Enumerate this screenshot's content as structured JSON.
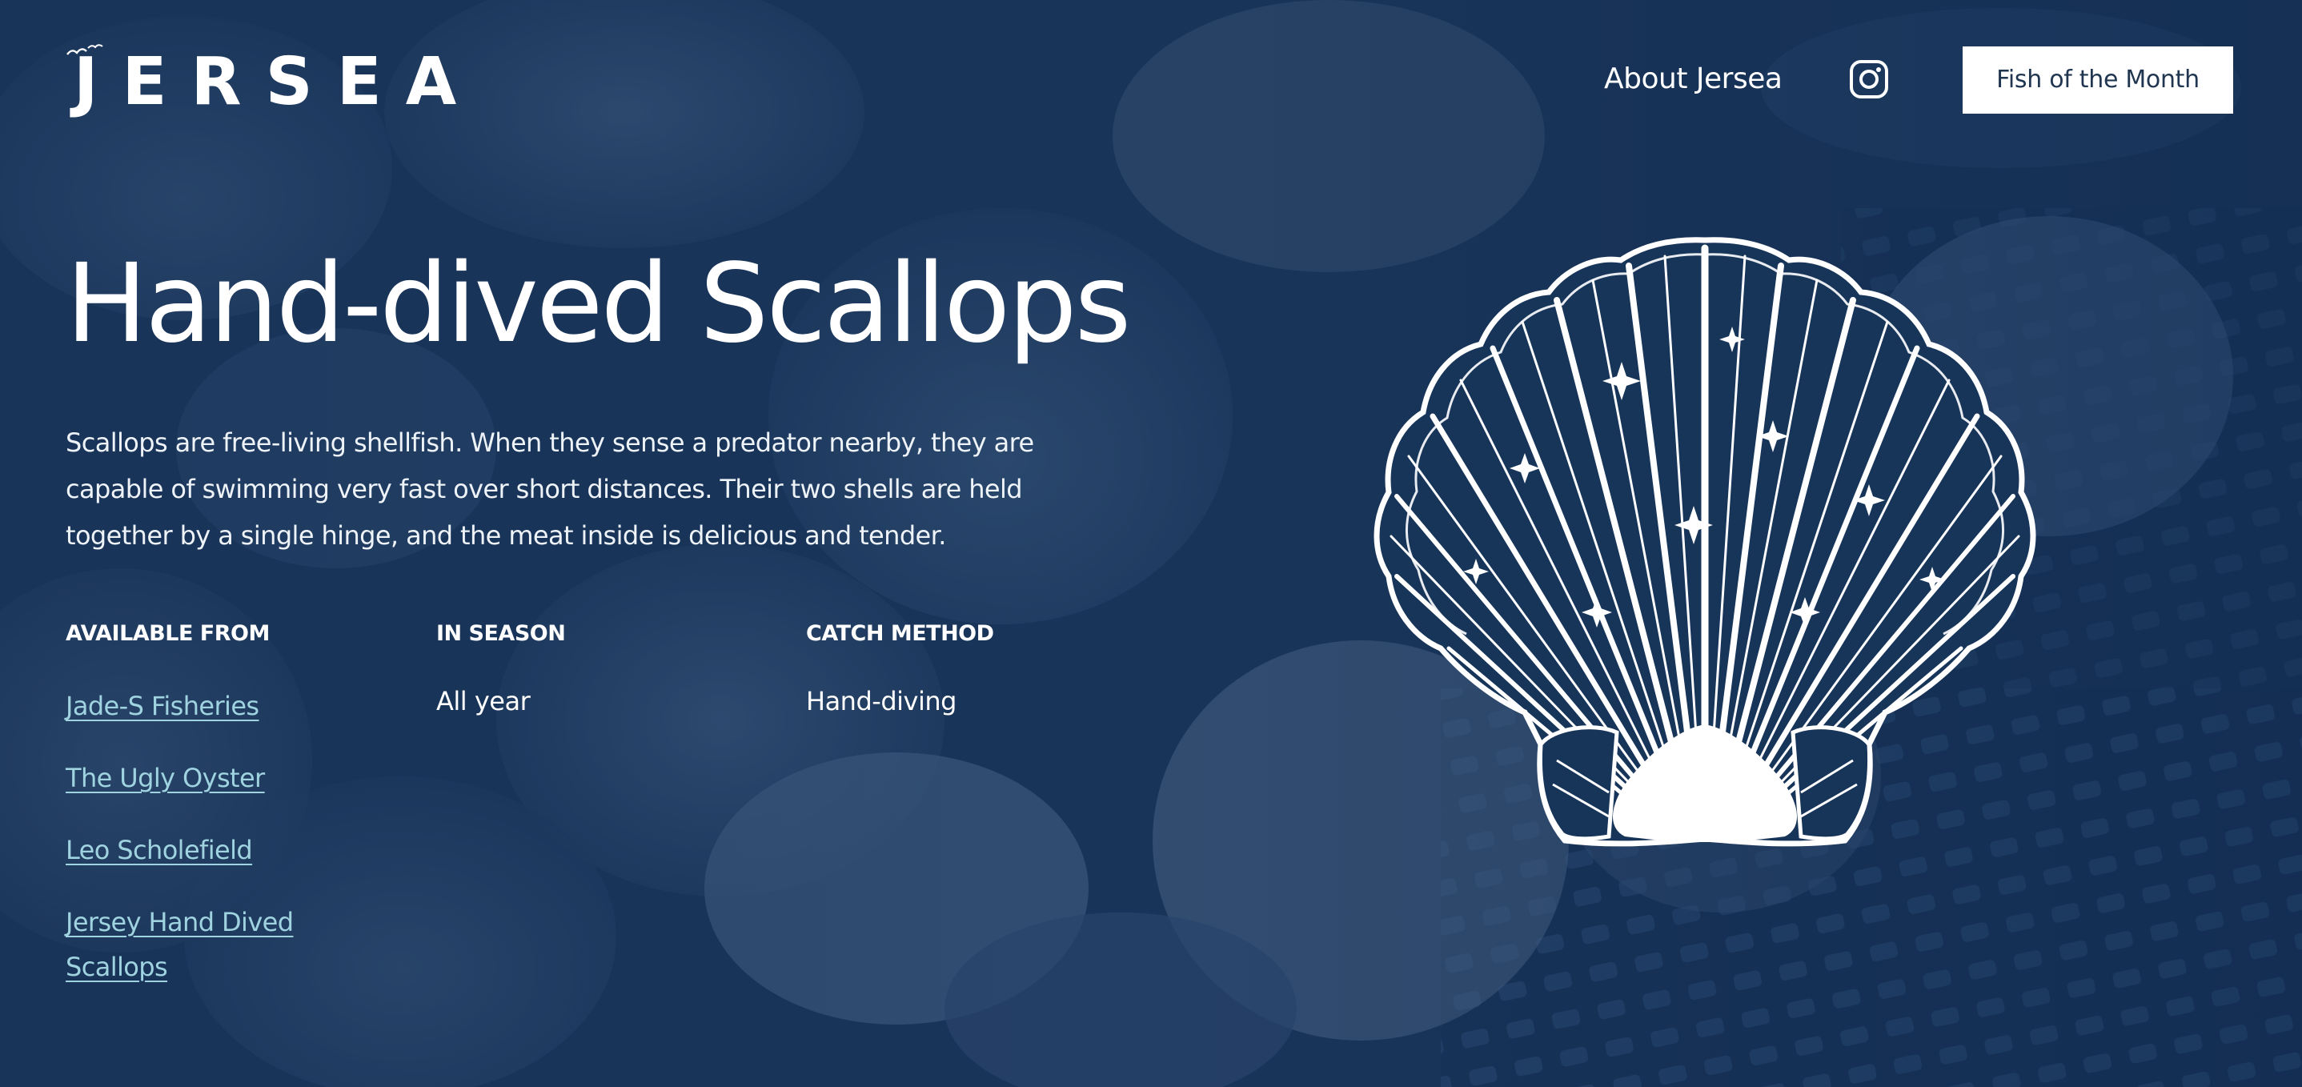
{
  "brand": {
    "logo_text": "JERSEA"
  },
  "nav": {
    "about_label": "About Jersea",
    "instagram_icon": "instagram-icon",
    "fish_button_label": "Fish of the Month"
  },
  "hero": {
    "title": "Hand-dived Scallops",
    "description": "Scallops are free-living shellfish. When they sense a predator nearby, they are capable of swimming very fast over short distances. Their two shells are held together by a single hinge, and the meat inside is delicious and tender.",
    "illustration_icon": "scallop-shell-icon"
  },
  "details": {
    "available_from": {
      "heading": "AVAILABLE FROM",
      "suppliers": [
        "Jade-S Fisheries",
        "The Ugly Oyster",
        "Leo Scholefield",
        "Jersey Hand Dived Scallops"
      ]
    },
    "in_season": {
      "heading": "IN SEASON",
      "value": "All year"
    },
    "catch_method": {
      "heading": "CATCH METHOD",
      "value": "Hand-diving"
    }
  },
  "colors": {
    "background": "#1a3659",
    "text": "#ffffff",
    "link": "#9fd3e0",
    "button_bg": "#ffffff",
    "button_text": "#1f3550"
  }
}
